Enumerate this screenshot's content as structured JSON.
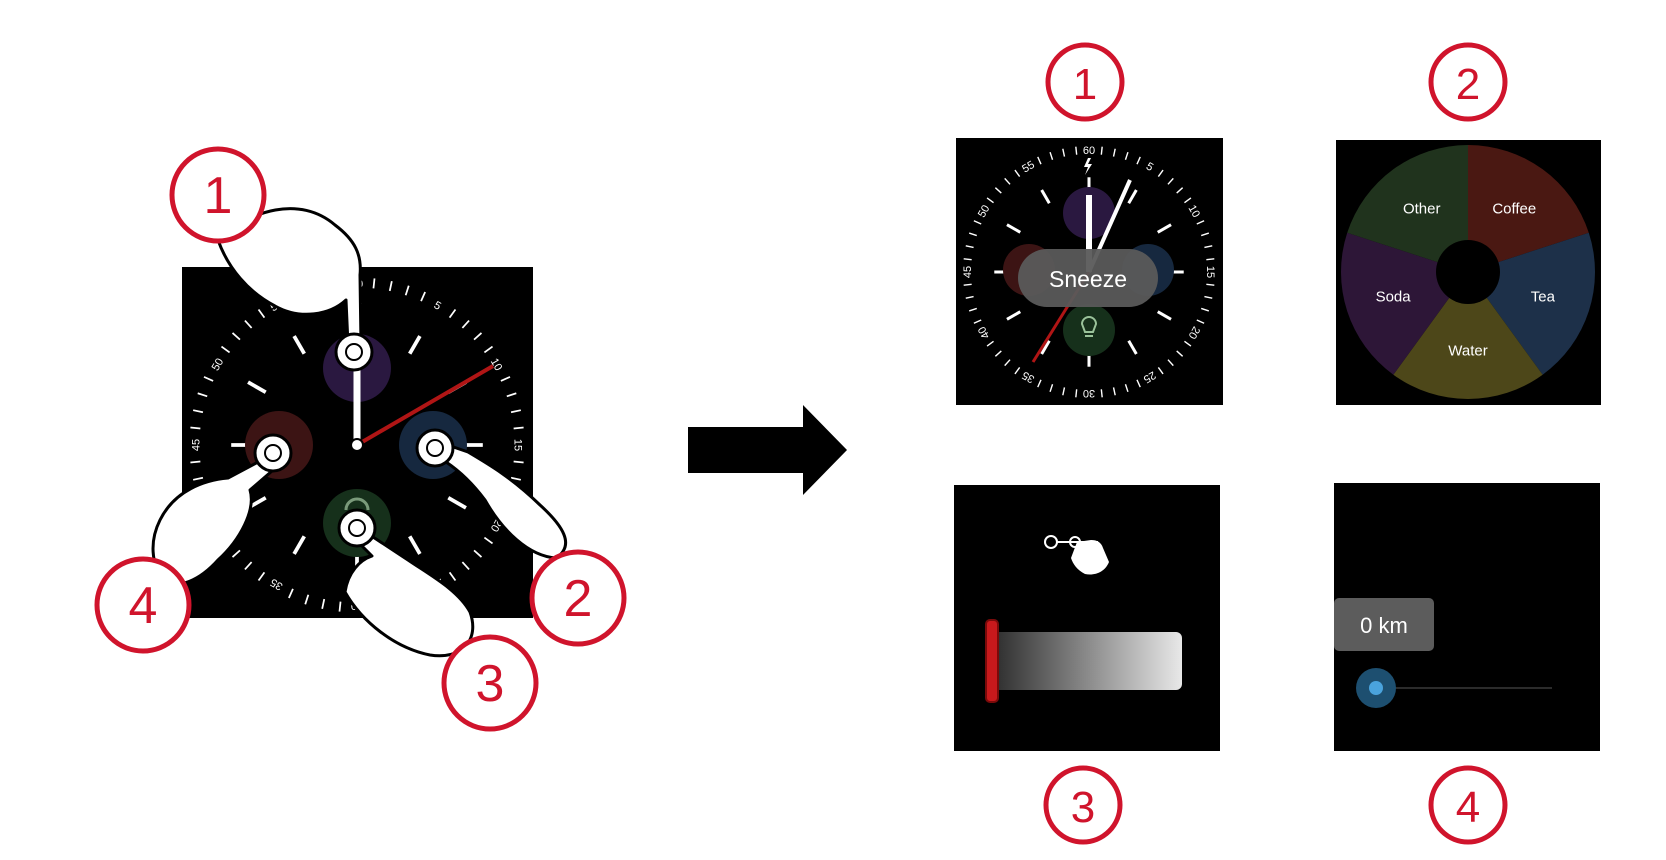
{
  "callouts": [
    "1",
    "2",
    "3",
    "4"
  ],
  "arrow": "right-arrow",
  "dial": {
    "numerals": [
      "60",
      "5",
      "10",
      "15",
      "20",
      "25",
      "30",
      "35",
      "40",
      "45",
      "50",
      "55"
    ],
    "complication_icons": [
      "bolt-icon",
      "beaker-icon",
      "glasses-icon",
      "dumbbell-icon",
      "lightbulb-icon"
    ]
  },
  "panel_1": {
    "toast": "Sneeze"
  },
  "panel_2": {
    "chart_data": {
      "type": "pie",
      "categories": [
        "Coffee",
        "Tea",
        "Water",
        "Soda",
        "Other"
      ],
      "values": [
        1,
        1,
        1,
        1,
        1
      ],
      "colors": [
        "#4a1812",
        "#1d3049",
        "#4d4719",
        "#2d1637",
        "#20331d"
      ]
    }
  },
  "panel_3": {
    "icon": "swipe-gesture-icon",
    "bar_fill_fraction": 0
  },
  "panel_4": {
    "value_label": "0 km",
    "slider_value_fraction": 0
  },
  "colors": {
    "accent_red": "#d0142c",
    "hand_red": "#b01515",
    "slider_blue": "#4aa3dd"
  }
}
